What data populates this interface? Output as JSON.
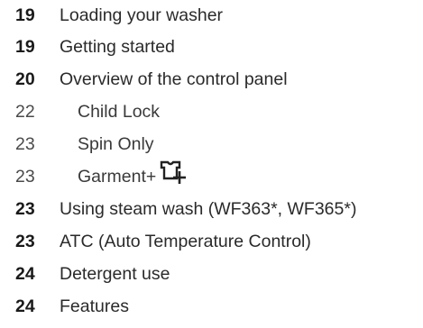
{
  "toc": {
    "entries": [
      {
        "page": "19",
        "title": "Loading your washer",
        "level": "main"
      },
      {
        "page": "19",
        "title": "Getting started",
        "level": "main"
      },
      {
        "page": "20",
        "title": "Overview of the control panel",
        "level": "main"
      },
      {
        "page": "22",
        "title": "Child Lock",
        "level": "sub"
      },
      {
        "page": "23",
        "title": "Spin Only",
        "level": "sub"
      },
      {
        "page": "23",
        "title": "Garment+",
        "level": "sub",
        "icon": "garment-plus-icon"
      },
      {
        "page": "23",
        "title": "Using steam wash (WF363*, WF365*)",
        "level": "main"
      },
      {
        "page": "23",
        "title": "ATC (Auto Temperature Control)",
        "level": "main"
      },
      {
        "page": "24",
        "title": "Detergent use",
        "level": "main"
      },
      {
        "page": "24",
        "title": "Features",
        "level": "main"
      }
    ]
  }
}
